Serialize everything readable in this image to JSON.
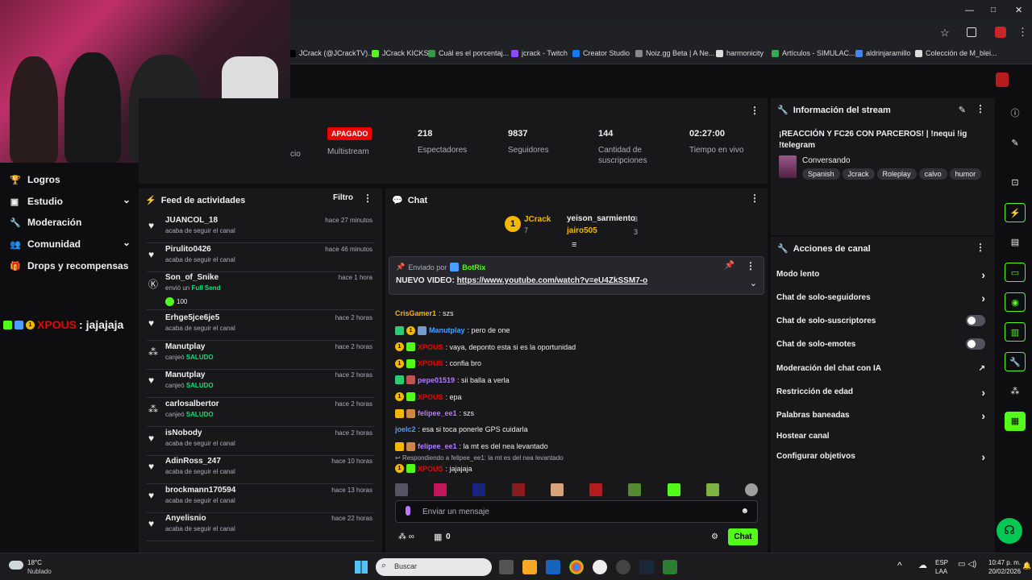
{
  "browser": {
    "window_controls": [
      "—",
      "□",
      "✕"
    ],
    "bookmarks": [
      {
        "label": "JCrack (@JCrackTV)...",
        "color": "#000"
      },
      {
        "label": "JCrack KICKS",
        "color": "#53fc18"
      },
      {
        "label": "Cuál es el porcentaj...",
        "color": "#2ea043"
      },
      {
        "label": "jcrack - Twitch",
        "color": "#9146ff"
      },
      {
        "label": "Creator Studio",
        "color": "#1877f2"
      },
      {
        "label": "Noiz.gg Beta | A Ne...",
        "color": "#888"
      },
      {
        "label": "harmonicity",
        "color": "#ddd"
      },
      {
        "label": "Artículos - SIMULAC...",
        "color": "#34a853"
      },
      {
        "label": "aldrinjaramillo",
        "color": "#4285f4"
      },
      {
        "label": "Colección de M_blei...",
        "color": "#ddd"
      }
    ]
  },
  "overlay": {
    "chat_user": "XPOUS",
    "chat_text": ": jajajaja"
  },
  "nav": [
    {
      "label": "Logros",
      "icon": "trophy-icon"
    },
    {
      "label": "Estudio",
      "icon": "studio-icon"
    },
    {
      "label": "Moderación",
      "icon": "wrench-icon"
    },
    {
      "label": "Comunidad",
      "icon": "people-icon"
    },
    {
      "label": "Drops y recompensas",
      "icon": "gift-icon"
    }
  ],
  "stats": {
    "partial_label": "cio",
    "multistream_badge": "APAGADO",
    "multistream_label": "Multistream",
    "viewers": "218",
    "viewers_label": "Espectadores",
    "followers": "9837",
    "followers_label": "Seguidores",
    "subs": "144",
    "subs_label": "Cantidad de suscripciones",
    "uptime": "02:27:00",
    "uptime_label": "Tiempo en vivo"
  },
  "feed": {
    "title": "Feed de actividades",
    "filter": "Filtro",
    "items": [
      {
        "name": "JUANCOL_18",
        "sub": "acaba de seguir el canal",
        "time": "hace 27 minutos",
        "icon": "heart"
      },
      {
        "name": "Pirulito0426",
        "sub": "acaba de seguir el canal",
        "time": "hace 46 minutos",
        "icon": "heart"
      },
      {
        "name": "Son_of_Snike",
        "sub": "envió un",
        "sub_hl": "Full Send",
        "amount": "100",
        "time": "hace 1 hora",
        "icon": "kick"
      },
      {
        "name": "Erhge5jce6je5",
        "sub": "acaba de seguir el canal",
        "time": "hace 2 horas",
        "icon": "heart"
      },
      {
        "name": "Manutplay",
        "sub": "canjeó",
        "sub_hl": "SALUDO",
        "time": "hace 2 horas",
        "icon": "reward"
      },
      {
        "name": "Manutplay",
        "sub": "canjeó",
        "sub_hl": "SALUDO",
        "time": "hace 2 horas",
        "icon": "heart"
      },
      {
        "name": "carlosalbertor",
        "sub": "canjeó",
        "sub_hl": "SALUDO",
        "time": "hace 2 horas",
        "icon": "reward"
      },
      {
        "name": "isNobody",
        "sub": "acaba de seguir el canal",
        "time": "hace 2 horas",
        "icon": "heart"
      },
      {
        "name": "AdinRoss_247",
        "sub": "acaba de seguir el canal",
        "time": "hace 10 horas",
        "icon": "heart"
      },
      {
        "name": "brockmann170594",
        "sub": "acaba de seguir el canal",
        "time": "hace 13 horas",
        "icon": "heart"
      },
      {
        "name": "Anyelisnio",
        "sub": "acaba de seguir el canal",
        "time": "hace 22 horas",
        "icon": "heart"
      }
    ]
  },
  "chat": {
    "title": "Chat",
    "top_gifters": [
      {
        "name": "JCrack",
        "count": "7",
        "color": "#f5b800"
      },
      {
        "name": "yeison_sarmiento",
        "count": "3",
        "color": "#efeff1"
      },
      {
        "name": "jairo505",
        "count": "3",
        "color": "#f5b800"
      }
    ],
    "pinned_by_label": "Enviado por",
    "pinned_by": "BotRix",
    "pinned_prefix": "NUEVO VIDEO: ",
    "pinned_link": "https://www.youtube.com/watch?v=eU4ZkSSM7-o",
    "messages": [
      {
        "user": "CrisGamer1",
        "color": "#f5b800",
        "text": ": szs",
        "badges": []
      },
      {
        "user": "Manutplay",
        "color": "#4c9fff",
        "text": ": pero de one",
        "badges": [
          "#2ecc71",
          "o",
          "#79c"
        ]
      },
      {
        "user": "XPOUS",
        "color": "#eb0400",
        "text": ": vaya, deponto esta si es la oportunidad",
        "badges": [
          "o",
          "#53fc18"
        ]
      },
      {
        "user": "XPOUS",
        "color": "#eb0400",
        "text": ": confia bro",
        "badges": [
          "o",
          "#53fc18"
        ]
      },
      {
        "user": "pepe01519",
        "color": "#b779ff",
        "text": ": sii balla a verla",
        "badges": [
          "#2ecc71",
          "#b55"
        ]
      },
      {
        "user": "XPOUS",
        "color": "#eb0400",
        "text": ": epa",
        "badges": [
          "o",
          "#53fc18"
        ]
      },
      {
        "user": "felipee_ee1",
        "color": "#b779ff",
        "text": ": szs",
        "badges": [
          "#f5b800",
          "#c84"
        ]
      },
      {
        "user": "joelc2",
        "color": "#4c9fff",
        "text": ": esa si toca ponerle GPS cuidarla",
        "badges": []
      },
      {
        "user": "felipee_ee1",
        "color": "#b779ff",
        "text": ": la mt es del nea levantado",
        "badges": [
          "#f5b800",
          "#c84"
        ]
      }
    ],
    "reply_to": "Respondiendo a felipee_ee1: la mt es del nea levantado",
    "last_user": "XPOUS",
    "last_text": ": jajajaja",
    "input_placeholder": "Enviar un mensaje",
    "points": "0",
    "send_label": "Chat"
  },
  "stream_info": {
    "title": "Información del stream",
    "stream_title": "¡REACCIÓN Y FC26 CON PARCEROS! | !nequi !ig !telegram",
    "category": "Conversando",
    "tags": [
      "Spanish",
      "Jcrack",
      "Roleplay",
      "calvo",
      "humor"
    ]
  },
  "actions": {
    "title": "Acciones de canal",
    "items": [
      {
        "label": "Modo lento",
        "ctrl": "chevron"
      },
      {
        "label": "Chat de solo-seguidores",
        "ctrl": "chevron"
      },
      {
        "label": "Chat de solo-suscriptores",
        "ctrl": "toggle"
      },
      {
        "label": "Chat de solo-emotes",
        "ctrl": "toggle"
      },
      {
        "label": "Moderación del chat con IA",
        "ctrl": "external"
      },
      {
        "label": "Restricción de edad",
        "ctrl": "chevron"
      },
      {
        "label": "Palabras baneadas",
        "ctrl": "chevron"
      },
      {
        "label": "Hostear canal",
        "ctrl": "none"
      },
      {
        "label": "Configurar objetivos",
        "ctrl": "chevron"
      }
    ]
  },
  "taskbar": {
    "temp": "18°C",
    "weather": "Nublado",
    "search": "Buscar",
    "lang1": "ESP",
    "lang2": "LAA",
    "time": "10:47 p. m.",
    "date": "20/02/2026"
  }
}
